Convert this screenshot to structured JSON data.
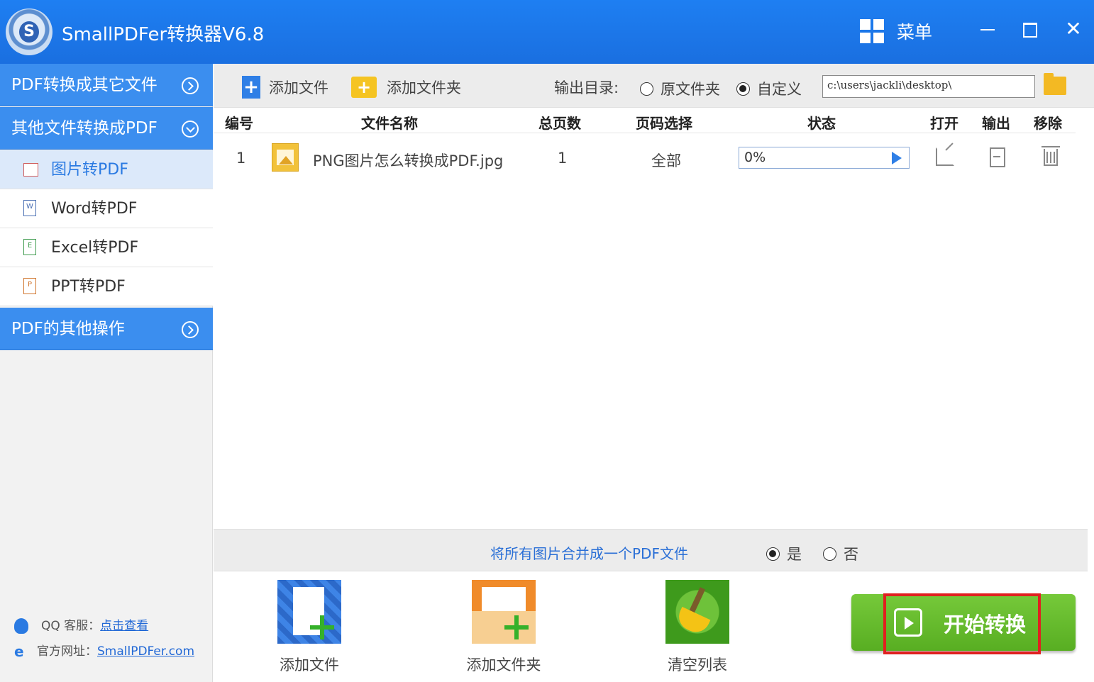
{
  "window": {
    "title": "SmallPDFer转换器V6.8",
    "menu_label": "菜单",
    "logo_letter": "S",
    "close_glyph": "✕"
  },
  "sidebar": {
    "sections": [
      {
        "label": "PDF转换成其它文件"
      },
      {
        "label": "其他文件转换成PDF"
      },
      {
        "label": "PDF的其他操作"
      }
    ],
    "items": [
      {
        "label": "图片转PDF",
        "icon_text": ""
      },
      {
        "label": "Word转PDF",
        "icon_text": "W"
      },
      {
        "label": "Excel转PDF",
        "icon_text": "E"
      },
      {
        "label": "PPT转PDF",
        "icon_text": "P"
      }
    ],
    "support": {
      "qq_label": "QQ 客服：",
      "qq_link": "点击查看",
      "site_label": "官方网址：",
      "site_link": "SmallPDFer.com",
      "ie_glyph": "e"
    }
  },
  "toolbar": {
    "add_file": "添加文件",
    "add_folder": "添加文件夹",
    "output_dir_label": "输出目录:",
    "radio_source": "原文件夹",
    "radio_custom": "自定义",
    "path_value": "c:\\users\\jackli\\desktop\\",
    "plus_glyph": "+"
  },
  "table": {
    "headers": {
      "num": "编号",
      "name": "文件名称",
      "pages": "总页数",
      "range": "页码选择",
      "status": "状态",
      "open": "打开",
      "output": "输出",
      "remove": "移除"
    },
    "rows": [
      {
        "num": "1",
        "name": "PNG图片怎么转换成PDF.jpg",
        "pages": "1",
        "range": "全部",
        "progress": "0%"
      }
    ]
  },
  "merge": {
    "label": "将所有图片合并成一个PDF文件",
    "yes": "是",
    "no": "否"
  },
  "actions": {
    "add_file": "添加文件",
    "add_folder": "添加文件夹",
    "clear_list": "清空列表",
    "start": "开始转换"
  }
}
